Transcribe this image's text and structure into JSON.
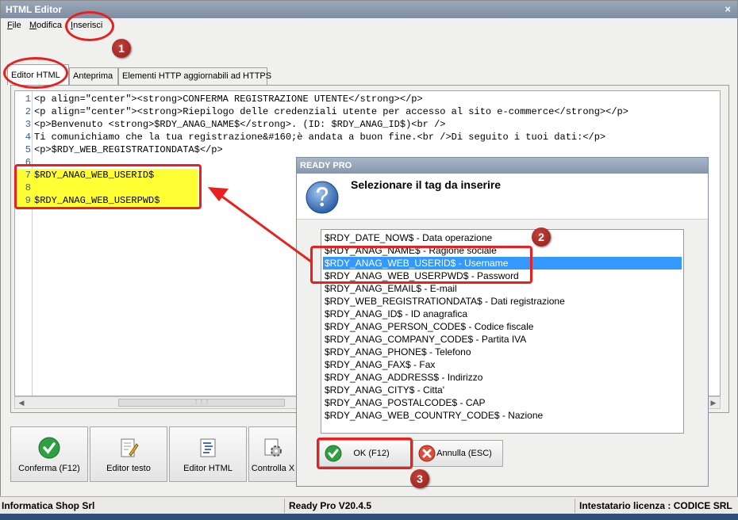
{
  "window": {
    "title": "HTML Editor",
    "close_glyph": "×"
  },
  "menu": [
    "File",
    "Modifica",
    "Inserisci"
  ],
  "tabs": [
    "Editor HTML",
    "Anteprima",
    "Elementi HTTP aggiornabili ad HTTPS"
  ],
  "editor": {
    "lines": [
      {
        "num": "1",
        "text": "<p align=\"center\"><strong>CONFERMA REGISTRAZIONE UTENTE</strong></p>"
      },
      {
        "num": "2",
        "text": "<p align=\"center\"><strong>Riepilogo delle credenziali utente per accesso al sito e-commerce</strong></p>"
      },
      {
        "num": "3",
        "text": "<p>Benvenuto <strong>$RDY_ANAG_NAME$</strong>. (ID: $RDY_ANAG_ID$)<br />"
      },
      {
        "num": "4",
        "text": "Ti comunichiamo che la tua registrazione&#160;è andata a buon fine.<br />Di seguito i tuoi dati:</p>"
      },
      {
        "num": "5",
        "text": "<p>$RDY_WEB_REGISTRATIONDATA$</p>"
      },
      {
        "num": "6",
        "text": ""
      },
      {
        "num": "7",
        "text": "$RDY_ANAG_WEB_USERID$"
      },
      {
        "num": "8",
        "text": ""
      },
      {
        "num": "9",
        "text": "$RDY_ANAG_WEB_USERPWD$"
      }
    ]
  },
  "toolbar": [
    {
      "label": "Conferma (F12)",
      "icon": "check-icon"
    },
    {
      "label": "Editor testo",
      "icon": "edit-icon"
    },
    {
      "label": "Editor HTML",
      "icon": "html-doc-icon"
    },
    {
      "label": "Controlla X",
      "icon": "gear-icon"
    }
  ],
  "dialog": {
    "title": "READY PRO",
    "heading": "Selezionare il tag da inserire",
    "items": [
      "$RDY_DATE_NOW$ - Data operazione",
      "$RDY_ANAG_NAME$ - Ragione sociale",
      "$RDY_ANAG_WEB_USERID$ - Username",
      "$RDY_ANAG_WEB_USERPWD$ - Password",
      "$RDY_ANAG_EMAIL$ - E-mail",
      "$RDY_WEB_REGISTRATIONDATA$ - Dati registrazione",
      "$RDY_ANAG_ID$ - ID anagrafica",
      "$RDY_ANAG_PERSON_CODE$ - Codice fiscale",
      "$RDY_ANAG_COMPANY_CODE$ - Partita IVA",
      "$RDY_ANAG_PHONE$ - Telefono",
      "$RDY_ANAG_FAX$ - Fax",
      "$RDY_ANAG_ADDRESS$ - Indirizzo",
      "$RDY_ANAG_CITY$ - Citta'",
      "$RDY_ANAG_POSTALCODE$ - CAP",
      "$RDY_ANAG_WEB_COUNTRY_CODE$ - Nazione"
    ],
    "selected_item": "$RDY_ANAG_WEB_USERID$ - Username",
    "ok_label": "OK (F12)",
    "cancel_label": "Annulla (ESC)"
  },
  "status": {
    "company": "Informatica Shop Srl",
    "version": "Ready Pro V20.4.5",
    "license": "Intestatario licenza : CODICE SRL"
  },
  "annotations": [
    "1",
    "2",
    "3"
  ],
  "colors": {
    "callout": "#e8201e",
    "badge": "#a32a24",
    "highlight": "#ffff33",
    "selection": "#3399ff",
    "line_number": "#2e64a6"
  }
}
